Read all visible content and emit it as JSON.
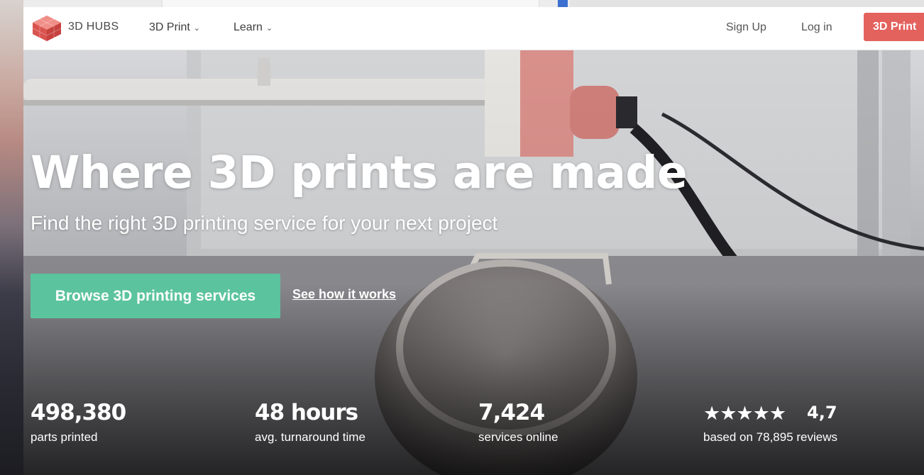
{
  "nav": {
    "brand": "3D HUBS",
    "menu": [
      {
        "label": "3D Print"
      },
      {
        "label": "Learn"
      }
    ],
    "sign_up": "Sign Up",
    "log_in": "Log in",
    "cta": "3D Print"
  },
  "hero": {
    "title": "Where 3D prints are made",
    "subtitle": "Find the right 3D printing service for your next project",
    "primary_button": "Browse 3D printing services",
    "secondary_link": "See how it works"
  },
  "stats": [
    {
      "value": "498,380",
      "label": "parts printed"
    },
    {
      "value": "48 hours",
      "label": "avg. turnaround time"
    },
    {
      "value": "7,424",
      "label": "services online"
    },
    {
      "stars": "★★★★★",
      "value": "4,7",
      "label": "based on 78,895 reviews"
    }
  ],
  "colors": {
    "cta_red": "#e3625e",
    "primary_green": "#5cc39f"
  },
  "icons": {
    "logo": "3d-hubs-cube-logo",
    "chevron": "chevron-down-icon",
    "star": "star-icon"
  }
}
